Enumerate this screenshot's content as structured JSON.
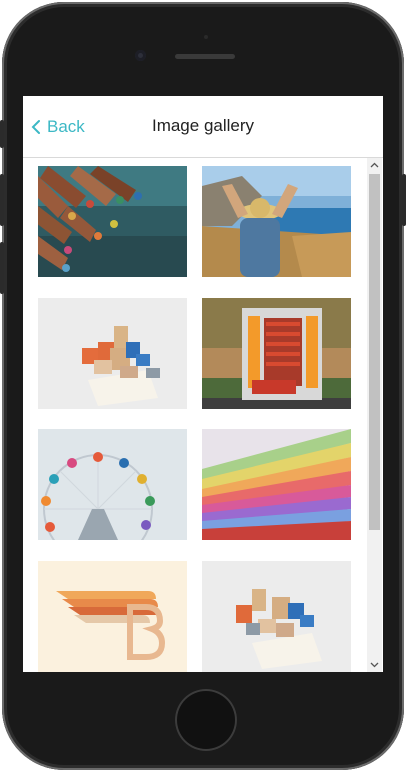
{
  "header": {
    "back_label": "Back",
    "title": "Image gallery"
  },
  "gallery": {
    "images": [
      {
        "icon": "colored-pencils-image"
      },
      {
        "icon": "woman-with-hat-coast-image"
      },
      {
        "icon": "cardboard-boxes-image"
      },
      {
        "icon": "orange-machine-image"
      },
      {
        "icon": "ferris-wheel-image"
      },
      {
        "icon": "color-swatches-image"
      },
      {
        "icon": "winged-b-logo-image"
      },
      {
        "icon": "cardboard-boxes-image"
      }
    ]
  },
  "colors": {
    "accent": "#3cb8c5",
    "title": "#222222",
    "scrollbar_thumb": "#c1c1c1"
  }
}
